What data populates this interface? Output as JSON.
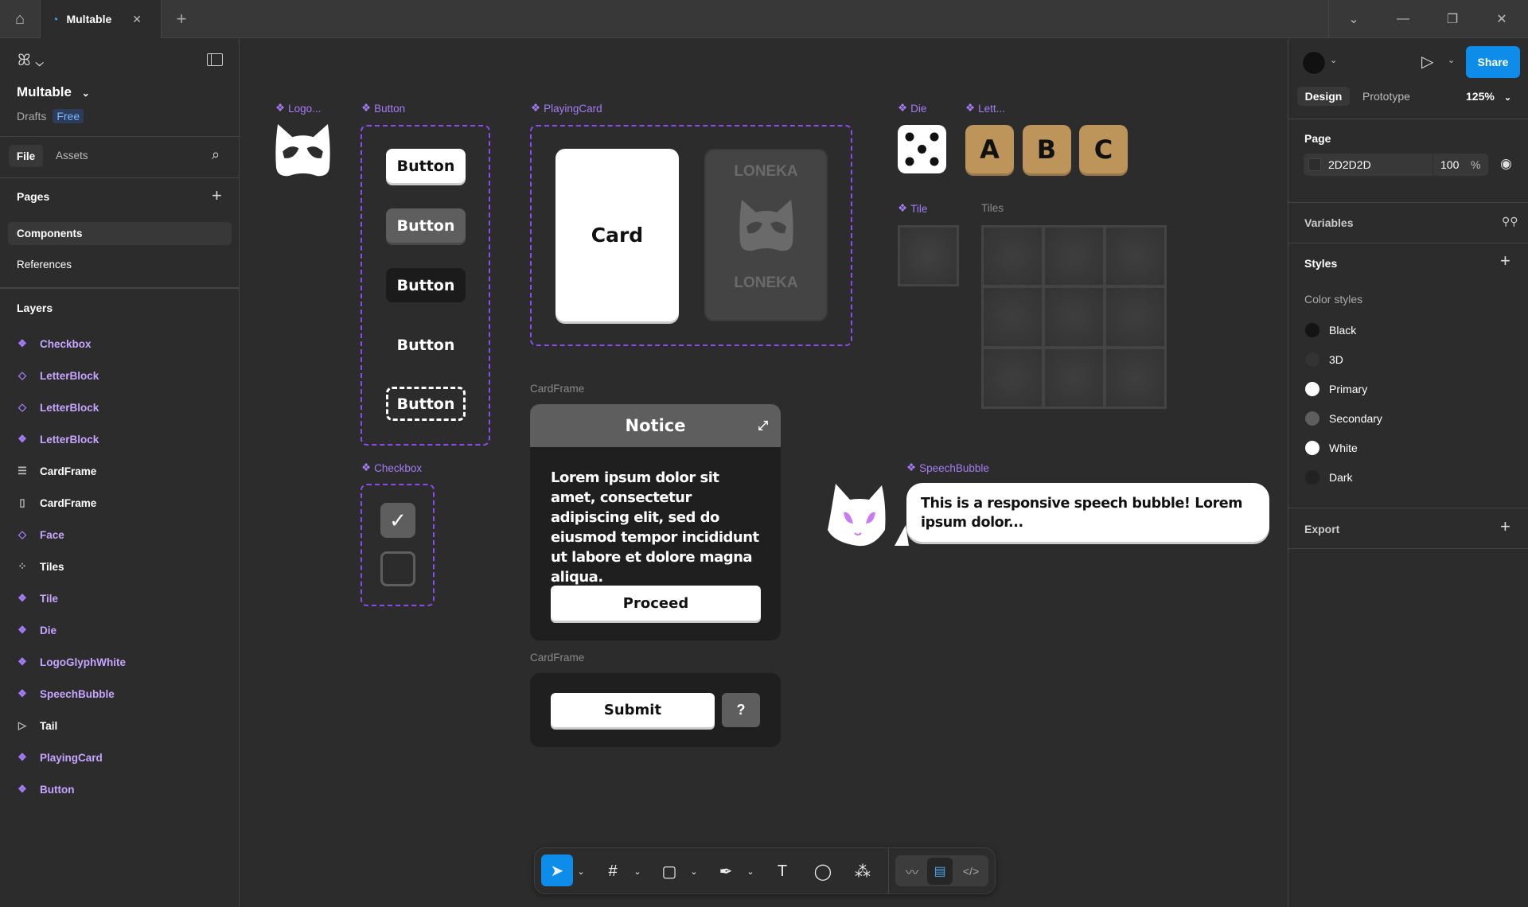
{
  "tabbar": {
    "file_tab": "Multable",
    "new_tab": "+"
  },
  "left": {
    "file_name": "Multable",
    "location": "Drafts",
    "plan_badge": "Free",
    "tabs": [
      "File",
      "Assets"
    ],
    "pages_title": "Pages",
    "pages": [
      "Components",
      "References"
    ],
    "layers_title": "Layers",
    "layers": [
      {
        "name": "Checkbox",
        "icon": "component",
        "purple": true
      },
      {
        "name": "LetterBlock",
        "icon": "instance",
        "purple": true
      },
      {
        "name": "LetterBlock",
        "icon": "instance",
        "purple": true
      },
      {
        "name": "LetterBlock",
        "icon": "component",
        "purple": true
      },
      {
        "name": "CardFrame",
        "icon": "autolayout-vertical",
        "purple": false
      },
      {
        "name": "CardFrame",
        "icon": "autolayout-horizontal",
        "purple": false
      },
      {
        "name": "Face",
        "icon": "instance",
        "purple": true
      },
      {
        "name": "Tiles",
        "icon": "grid",
        "purple": false
      },
      {
        "name": "Tile",
        "icon": "component",
        "purple": true
      },
      {
        "name": "Die",
        "icon": "component",
        "purple": true
      },
      {
        "name": "LogoGlyphWhite",
        "icon": "component",
        "purple": true
      },
      {
        "name": "SpeechBubble",
        "icon": "component",
        "purple": true
      },
      {
        "name": "Tail",
        "icon": "vector",
        "purple": false
      },
      {
        "name": "PlayingCard",
        "icon": "component",
        "purple": true
      },
      {
        "name": "Button",
        "icon": "component",
        "purple": true
      }
    ]
  },
  "canvas": {
    "logo_label": "Logo...",
    "button_label": "Button",
    "buttons": [
      "Button",
      "Button",
      "Button",
      "Button",
      "Button"
    ],
    "checkbox_label": "Checkbox",
    "playingcard_label": "PlayingCard",
    "card_front": "Card",
    "card_back_top": "LONEKA",
    "card_back_bottom": "LONEKA",
    "die_label": "Die",
    "letter_label": "Lett...",
    "letters": [
      "A",
      "B",
      "C"
    ],
    "tile_label": "Tile",
    "tiles_label": "Tiles",
    "cardframe_label": "CardFrame",
    "notice_title": "Notice",
    "notice_body": "Lorem ipsum dolor sit amet, consectetur adipiscing elit, sed do eiusmod tempor incididunt ut labore et dolore magna aliqua.",
    "proceed": "Proceed",
    "cardframe2_label": "CardFrame",
    "submit": "Submit",
    "help": "?",
    "speech_label": "SpeechBubble",
    "speech_text": "This is a responsive speech bubble! Lorem ipsum dolor...",
    "canvas_help": "?"
  },
  "right": {
    "share": "Share",
    "tabs": [
      "Design",
      "Prototype"
    ],
    "zoom": "125%",
    "page_title": "Page",
    "page_color": "2D2D2D",
    "page_opacity": "100",
    "percent": "%",
    "variables": "Variables",
    "styles": "Styles",
    "color_styles": "Color styles",
    "colors": [
      {
        "name": "Black",
        "hex": "#141414"
      },
      {
        "name": "3D",
        "hex": "#333333"
      },
      {
        "name": "Primary",
        "hex": "#ffffff"
      },
      {
        "name": "Secondary",
        "hex": "#5e5e5e"
      },
      {
        "name": "White",
        "hex": "#ffffff"
      },
      {
        "name": "Dark",
        "hex": "#222222"
      }
    ],
    "export": "Export"
  },
  "colors": {
    "accent": "#0d8ce9",
    "component": "#8a4cf0",
    "gold": "#bd9459"
  }
}
